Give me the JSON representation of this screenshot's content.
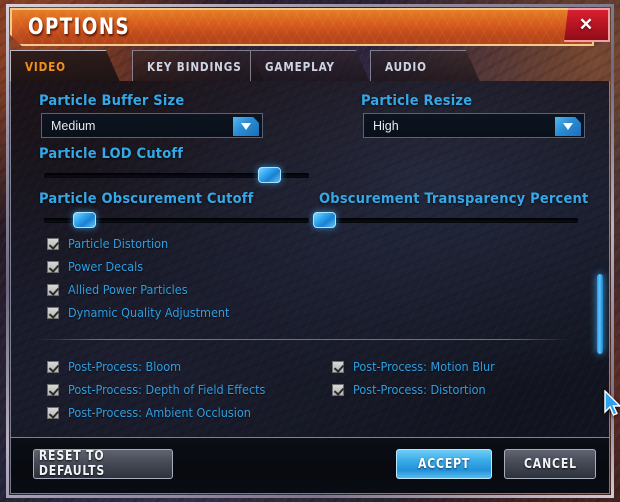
{
  "window": {
    "title": "OPTIONS",
    "close_label": "✕"
  },
  "tabs": [
    {
      "label": "VIDEO",
      "active": true
    },
    {
      "label": "KEY BINDINGS",
      "active": false
    },
    {
      "label": "GAMEPLAY",
      "active": false
    },
    {
      "label": "AUDIO",
      "active": false
    }
  ],
  "dropdowns": [
    {
      "label": "Particle Buffer Size",
      "value": "Medium"
    },
    {
      "label": "Particle Resize",
      "value": "High"
    }
  ],
  "sliders": [
    {
      "label": "Particle LOD Cutoff",
      "percent": 85
    },
    {
      "label": "Particle Obscurement Cutoff",
      "percent": 15
    },
    {
      "label": "Obscurement Transparency Percent",
      "percent": 3
    }
  ],
  "checkboxes_main": [
    {
      "label": "Particle Distortion",
      "checked": true
    },
    {
      "label": "Power Decals",
      "checked": true
    },
    {
      "label": "Allied Power Particles",
      "checked": true
    },
    {
      "label": "Dynamic Quality Adjustment",
      "checked": true
    }
  ],
  "checkboxes_post_left": [
    {
      "label": "Post-Process: Bloom",
      "checked": true
    },
    {
      "label": "Post-Process: Depth of Field Effects",
      "checked": true
    },
    {
      "label": "Post-Process: Ambient Occlusion",
      "checked": true
    }
  ],
  "checkboxes_post_right": [
    {
      "label": "Post-Process: Motion Blur",
      "checked": true
    },
    {
      "label": "Post-Process: Distortion",
      "checked": true
    }
  ],
  "footer": {
    "reset_label": "RESET TO DEFAULTS",
    "accept_label": "ACCEPT",
    "cancel_label": "CANCEL"
  },
  "colors": {
    "title_orange": "#d4591b",
    "accent_blue": "#35a8e8",
    "active_tab_text": "#f0901c",
    "close_red": "#b21421",
    "label_blue": "#2f9fe2"
  }
}
